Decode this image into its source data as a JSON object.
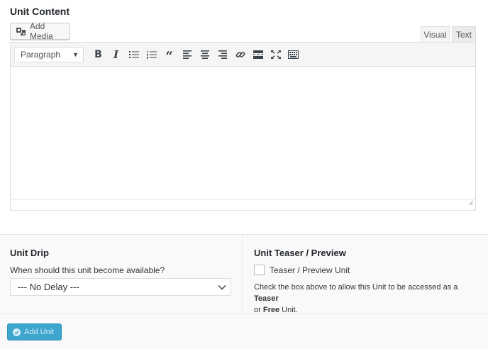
{
  "content": {
    "title": "Unit Content",
    "add_media_label": "Add Media",
    "tabs": {
      "visual": "Visual",
      "text": "Text"
    }
  },
  "toolbar": {
    "format_value": "Paragraph",
    "bold": "B",
    "italic": "I",
    "blockquote": "“"
  },
  "drip": {
    "title": "Unit Drip",
    "question": "When should this unit become available?",
    "selected": "--- No Delay ---"
  },
  "teaser": {
    "title": "Unit Teaser / Preview",
    "checkbox_label": "Teaser / Preview Unit",
    "help_prefix": "Check the box above to allow this Unit to be accessed as a ",
    "help_bold_1": "Teaser",
    "help_middle": "or ",
    "help_bold_2": "Free",
    "help_suffix": " Unit."
  },
  "footer": {
    "add_unit_label": "Add Unit"
  },
  "colors": {
    "accent": "#3ea5cf",
    "border": "#dddddd",
    "panel_bg": "#f9f9f9"
  }
}
